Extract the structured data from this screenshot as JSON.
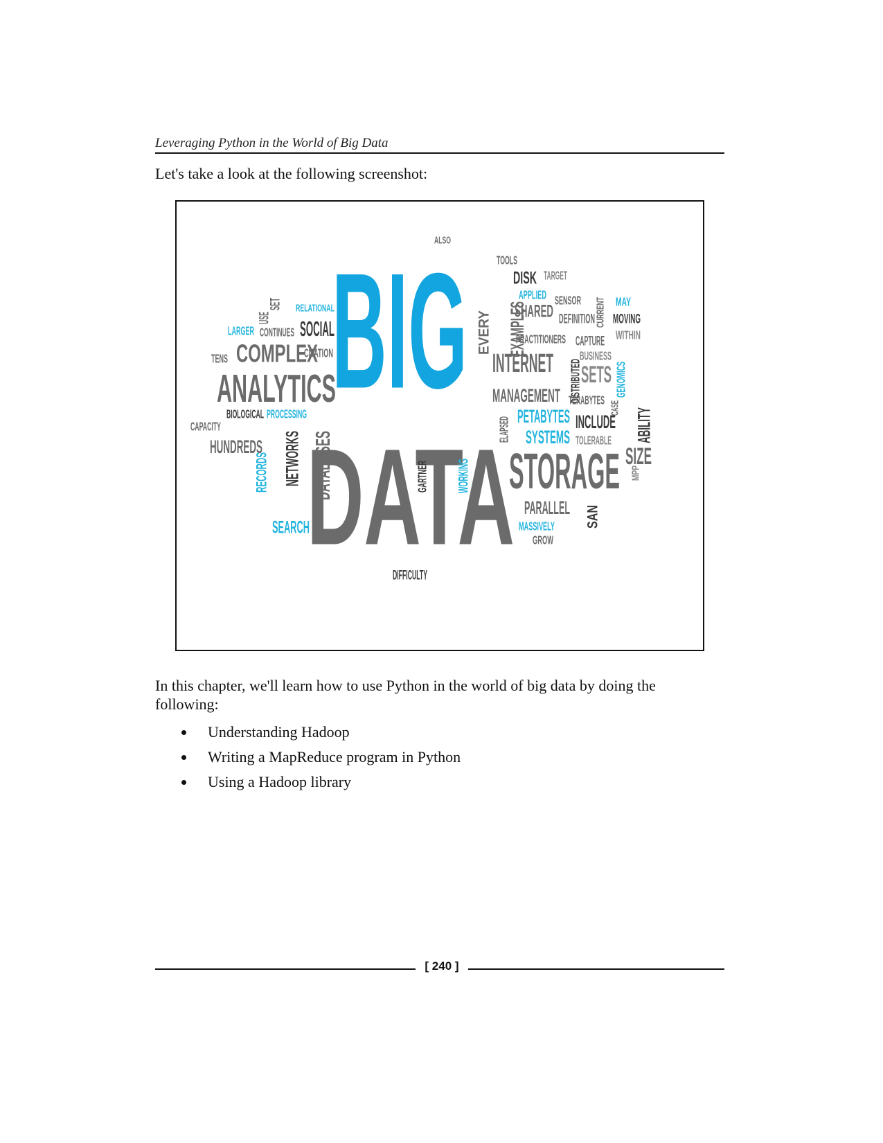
{
  "running_header": "Leveraging Python in the World of Big Data",
  "intro": "Let's take a look at the following screenshot:",
  "figure": {
    "description_words": [
      {
        "text": "BIG",
        "color": "#12a5df"
      },
      {
        "text": "DATA",
        "color": "#6b6b6b"
      },
      {
        "text": "ANALYTICS",
        "color": "#6b6b6b"
      },
      {
        "text": "COMPLEX",
        "color": "#6b6b6b"
      },
      {
        "text": "SOCIAL",
        "color": "#3a3a3a"
      },
      {
        "text": "CITATION",
        "color": "#6b6b6b"
      },
      {
        "text": "RELATIONAL",
        "color": "#23b4de"
      },
      {
        "text": "LARGER",
        "color": "#23b4de"
      },
      {
        "text": "CONTINUES",
        "color": "#6b6b6b"
      },
      {
        "text": "TENS",
        "color": "#6b6b6b"
      },
      {
        "text": "SET",
        "color": "#6b6b6b"
      },
      {
        "text": "USE",
        "color": "#6b6b6b"
      },
      {
        "text": "BIOLOGICAL",
        "color": "#3a3a3a"
      },
      {
        "text": "PROCESSING",
        "color": "#23b4de"
      },
      {
        "text": "CAPACITY",
        "color": "#6b6b6b"
      },
      {
        "text": "HUNDREDS",
        "color": "#6b6b6b"
      },
      {
        "text": "RECORDS",
        "color": "#23b4de"
      },
      {
        "text": "NETWORKS",
        "color": "#3a3a3a"
      },
      {
        "text": "DATABASES",
        "color": "#6b6b6b"
      },
      {
        "text": "SEARCH",
        "color": "#23b4de"
      },
      {
        "text": "ALSO",
        "color": "#6b6b6b"
      },
      {
        "text": "TOOLS",
        "color": "#6b6b6b"
      },
      {
        "text": "DISK",
        "color": "#3a3a3a"
      },
      {
        "text": "TARGET",
        "color": "#888888"
      },
      {
        "text": "APPLIED",
        "color": "#23b4de"
      },
      {
        "text": "SHARED",
        "color": "#6b6b6b"
      },
      {
        "text": "EXAMPLES",
        "color": "#6b6b6b"
      },
      {
        "text": "EVERY",
        "color": "#6b6b6b"
      },
      {
        "text": "SENSOR",
        "color": "#6b6b6b"
      },
      {
        "text": "DEFINITION",
        "color": "#6b6b6b"
      },
      {
        "text": "CURRENT",
        "color": "#6b6b6b"
      },
      {
        "text": "MAY",
        "color": "#23b4de"
      },
      {
        "text": "MOVING",
        "color": "#3a3a3a"
      },
      {
        "text": "WITHIN",
        "color": "#888888"
      },
      {
        "text": "PRACTITIONERS",
        "color": "#6b6b6b"
      },
      {
        "text": "CAPTURE",
        "color": "#6b6b6b"
      },
      {
        "text": "BUSINESS",
        "color": "#888888"
      },
      {
        "text": "INTERNET",
        "color": "#6b6b6b"
      },
      {
        "text": "DISTRIBUTED",
        "color": "#3a3a3a"
      },
      {
        "text": "SETS",
        "color": "#888888"
      },
      {
        "text": "GENOMICS",
        "color": "#23b4de"
      },
      {
        "text": "MANAGEMENT",
        "color": "#6b6b6b"
      },
      {
        "text": "TERABYTES",
        "color": "#6b6b6b"
      },
      {
        "text": "CASE",
        "color": "#6b6b6b"
      },
      {
        "text": "ABILITY",
        "color": "#3a3a3a"
      },
      {
        "text": "PETABYTES",
        "color": "#23b4de"
      },
      {
        "text": "INCLUDE",
        "color": "#3a3a3a"
      },
      {
        "text": "ELAPSED",
        "color": "#6b6b6b"
      },
      {
        "text": "SYSTEMS",
        "color": "#23b4de"
      },
      {
        "text": "TOLERABLE",
        "color": "#888888"
      },
      {
        "text": "SIZE",
        "color": "#6b6b6b"
      },
      {
        "text": "MPP",
        "color": "#888888"
      },
      {
        "text": "STORAGE",
        "color": "#6b6b6b"
      },
      {
        "text": "GARTNER",
        "color": "#3a3a3a"
      },
      {
        "text": "WORKING",
        "color": "#23b4de"
      },
      {
        "text": "PARALLEL",
        "color": "#6b6b6b"
      },
      {
        "text": "SAN",
        "color": "#3a3a3a"
      },
      {
        "text": "MASSIVELY",
        "color": "#23b4de"
      },
      {
        "text": "GROW",
        "color": "#6b6b6b"
      },
      {
        "text": "DIFFICULTY",
        "color": "#3a3a3a"
      }
    ]
  },
  "body_paragraph": "In this chapter, we'll learn how to use Python in the world of big data by doing the following:",
  "bullets": [
    "Understanding Hadoop",
    "Writing a MapReduce program in Python",
    "Using a Hadoop library"
  ],
  "page_number": "[ 240 ]"
}
